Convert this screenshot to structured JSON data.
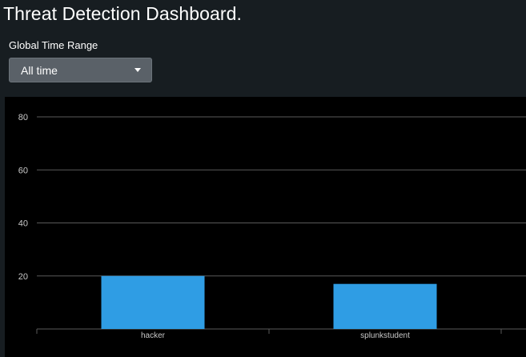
{
  "dashboard": {
    "title": "Threat Detection Dashboard."
  },
  "time_range": {
    "label": "Global Time Range",
    "selected": "All time"
  },
  "chart_data": {
    "type": "bar",
    "categories": [
      "hacker",
      "splunkstudent"
    ],
    "values": [
      20,
      17
    ],
    "ylim": [
      0,
      80
    ],
    "y_ticks": [
      20,
      40,
      60,
      80
    ],
    "grid": true,
    "bar_color": "#2f9de4",
    "background": "#000000",
    "gridline_color": "#5a5a5a"
  }
}
